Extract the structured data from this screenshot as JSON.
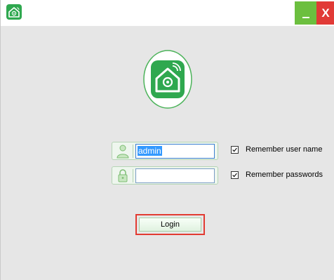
{
  "titlebar": {
    "icon": "house-wifi-icon",
    "minimize_icon": "minimize-icon",
    "close_icon": "close-icon",
    "close_glyph": "X",
    "minimize_color": "#6cbf3f",
    "close_color": "#e13a36"
  },
  "logo": {
    "icon": "house-wifi-icon",
    "accent": "#2fa84f"
  },
  "form": {
    "username": {
      "value": "admin",
      "icon": "user-icon"
    },
    "password": {
      "value": "",
      "icon": "lock-icon"
    },
    "remember_user": {
      "label": "Remember user name",
      "checked": true
    },
    "remember_password": {
      "label": "Remember passwords",
      "checked": true
    },
    "login_label": "Login"
  }
}
